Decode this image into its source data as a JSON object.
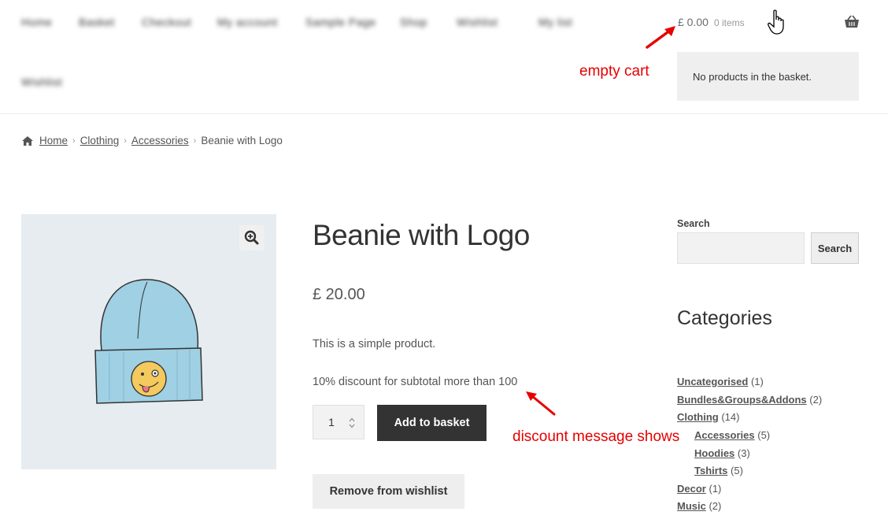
{
  "header": {
    "nav": [
      "Home",
      "Basket",
      "Checkout",
      "My account",
      "Sample Page",
      "Shop",
      "Wishlist",
      "My list",
      "Wishlist"
    ],
    "cart_amount": "£ 0.00",
    "cart_count": "0 items",
    "minicart_text": "No products in the basket."
  },
  "breadcrumb": {
    "home": "Home",
    "items": [
      "Clothing",
      "Accessories"
    ],
    "current": "Beanie with Logo",
    "separator": "›"
  },
  "product": {
    "title": "Beanie with Logo",
    "price": "£ 20.00",
    "description": "This is a simple product.",
    "discount_message": "10% discount for subtotal more than 100",
    "quantity": "1",
    "add_to_basket": "Add to basket",
    "remove_wishlist": "Remove from wishlist"
  },
  "sidebar": {
    "search_label": "Search",
    "search_placeholder": "",
    "search_button": "Search",
    "categories_title": "Categories",
    "categories": [
      {
        "name": "Uncategorised",
        "count": "(1)"
      },
      {
        "name": "Bundles&Groups&Addons",
        "count": "(2)"
      },
      {
        "name": "Clothing",
        "count": "(14)"
      },
      {
        "name": "Accessories",
        "count": "(5)"
      },
      {
        "name": "Hoodies",
        "count": "(3)"
      },
      {
        "name": "Tshirts",
        "count": "(5)"
      },
      {
        "name": "Decor",
        "count": "(1)"
      },
      {
        "name": "Music",
        "count": "(2)"
      }
    ]
  },
  "annotations": {
    "empty_cart": "empty cart",
    "discount_shows": "discount message shows"
  },
  "colors": {
    "accent_dark": "#333333",
    "annotation_red": "#e60000",
    "gallery_bg": "#e6ecf0",
    "beanie_blue": "#9fd0e4"
  }
}
